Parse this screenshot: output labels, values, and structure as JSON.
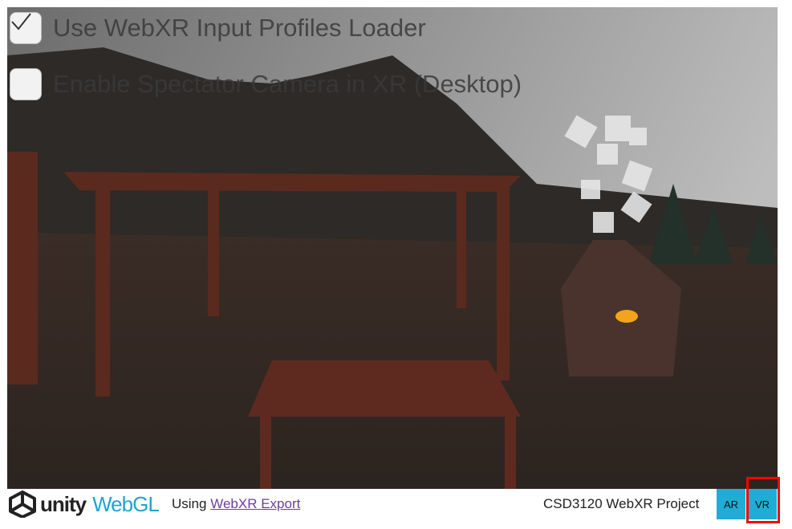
{
  "overlay": {
    "options": [
      {
        "label": "Use WebXR Input Profiles Loader",
        "checked": true
      },
      {
        "label": "Enable Spectator Camera in XR (Desktop)",
        "checked": false
      }
    ]
  },
  "footer": {
    "logo_unity": "unity",
    "logo_webgl": "WebGL",
    "using_text": "Using",
    "link_text": "WebXR Export",
    "project_title": "CSD3120 WebXR Project",
    "ar_button": "AR",
    "vr_button": "VR"
  },
  "colors": {
    "accent": "#1fadd6",
    "link": "#6b3fa0",
    "highlight": "#ff0000"
  }
}
